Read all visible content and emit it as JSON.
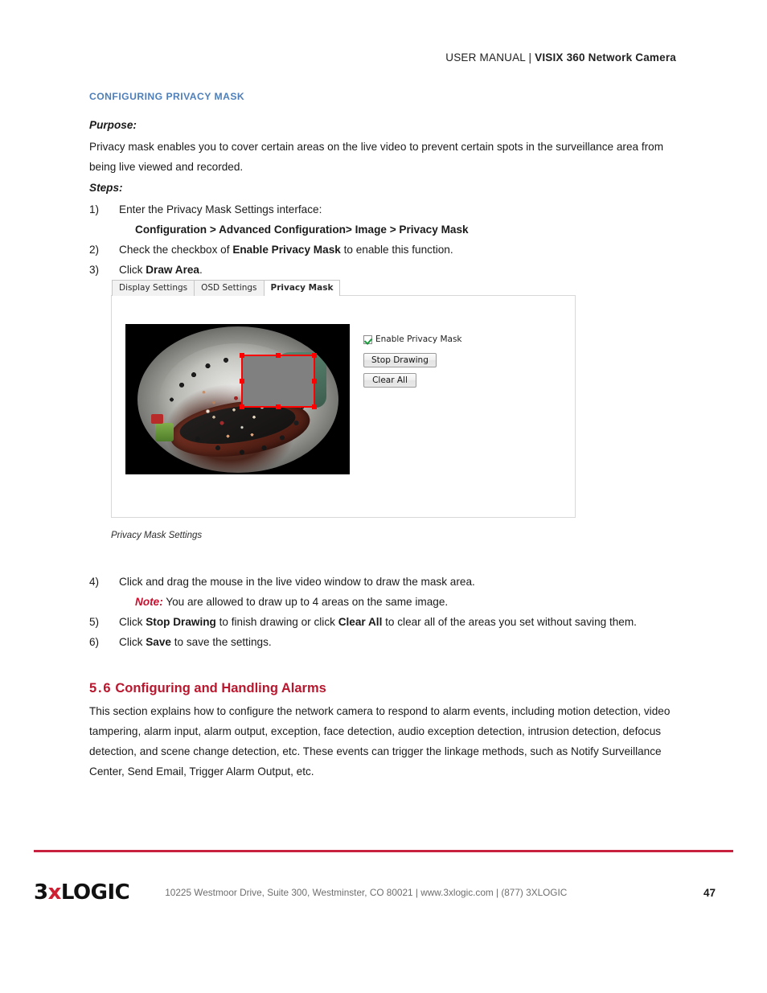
{
  "header": {
    "prefix": "USER MANUAL | ",
    "title": "VISIX 360 Network Camera"
  },
  "section": {
    "label": "CONFIGURING PRIVACY MASK",
    "purpose_label": "Purpose:",
    "purpose_text": "Privacy mask enables you to cover certain areas on the live video to prevent certain spots in the surveillance area from being live viewed and recorded.",
    "steps_label": "Steps:"
  },
  "steps": [
    {
      "num": "1)",
      "text": "Enter the Privacy Mask Settings interface:"
    },
    {
      "num": "2)",
      "text_pre": "Check the checkbox of ",
      "bold": "Enable Privacy Mask",
      "text_post": " to enable this function."
    },
    {
      "num": "3)",
      "text_pre": "Click ",
      "bold": "Draw Area",
      "text_post": "."
    },
    {
      "num": "4)",
      "text": "Click and drag the mouse in the live video window to draw the mask area."
    },
    {
      "num": "5)",
      "text_pre": "Click ",
      "bold": "Stop Drawing",
      "text_mid": " to finish drawing or click ",
      "bold2": "Clear All",
      "text_post": " to clear all of the areas you set without saving them."
    },
    {
      "num": "6)",
      "text_pre": "Click ",
      "bold": "Save",
      "text_post": " to save the settings."
    }
  ],
  "step1_path": "Configuration > Advanced Configuration> Image > Privacy Mask",
  "note": {
    "label": "Note:",
    "text": " You are allowed to draw up to 4 areas on the same image."
  },
  "figure": {
    "caption": "Privacy Mask Settings",
    "tabs": [
      {
        "label": "Display Settings",
        "active": false
      },
      {
        "label": "OSD Settings",
        "active": false
      },
      {
        "label": "Privacy Mask",
        "active": true
      }
    ],
    "checkbox_label": "Enable Privacy Mask",
    "checkbox_checked": true,
    "buttons": [
      {
        "label": "Stop Drawing"
      },
      {
        "label": "Clear All"
      }
    ],
    "mask_color": "#808080",
    "mask_border_color": "#ff0000"
  },
  "section56": {
    "number": "5.6",
    "title": "Configuring and Handling Alarms",
    "body": "This section explains how to configure the network camera to respond to alarm events, including motion detection, video tampering, alarm input, alarm output, exception, face detection, audio exception detection, intrusion detection, defocus detection, and scene change detection, etc. These events can trigger the linkage methods, such as Notify Surveillance Center, Send Email, Trigger Alarm Output, etc."
  },
  "footer": {
    "logo_pre": "3",
    "logo_x": "x",
    "logo_post": "LOGIC",
    "text": "10225 Westmoor Drive, Suite 300, Westminster, CO 80021 | www.3xlogic.com | (877) 3XLOGIC",
    "page_number": "47"
  },
  "colors": {
    "heading_blue": "#4e7fba",
    "heading_red": "#b8172e",
    "note_red": "#c8102e",
    "rule_red": "#c8203f"
  }
}
